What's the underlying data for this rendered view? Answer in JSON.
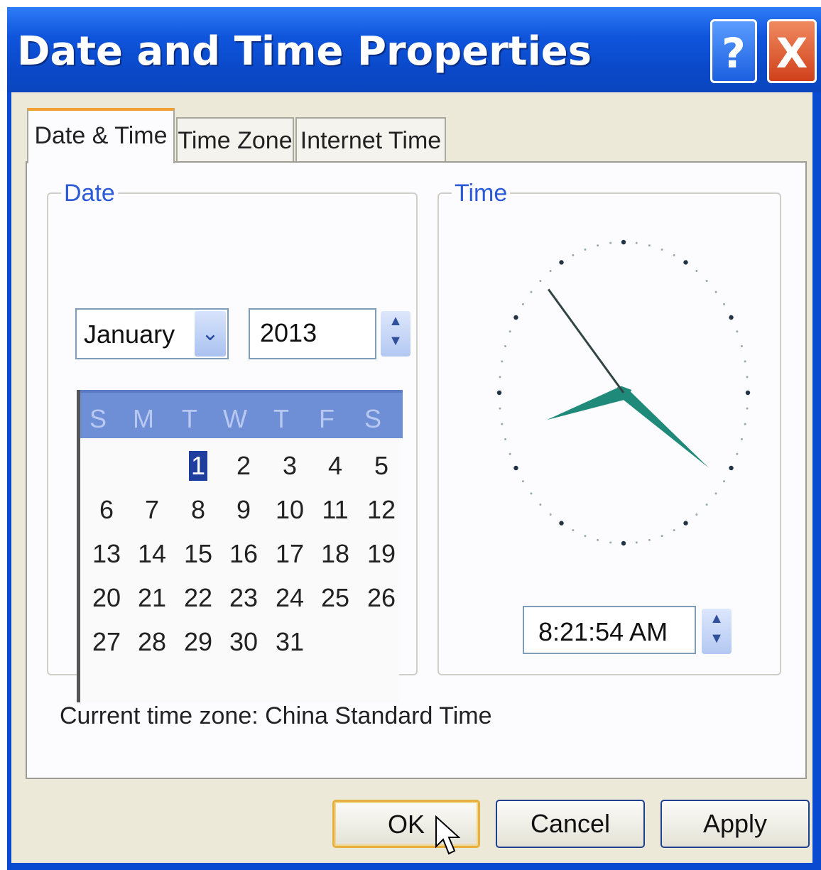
{
  "window": {
    "title": "Date and Time Properties",
    "help_glyph": "?",
    "close_glyph": "X"
  },
  "tabs": [
    {
      "label": "Date & Time",
      "active": true
    },
    {
      "label": "Time Zone",
      "active": false
    },
    {
      "label": "Internet Time",
      "active": false
    }
  ],
  "date_group": {
    "label": "Date",
    "month": "January",
    "year": "2013",
    "weekdays": [
      "S",
      "M",
      "T",
      "W",
      "T",
      "F",
      "S"
    ],
    "selected_day": "1",
    "days": [
      "1",
      "2",
      "3",
      "4",
      "5",
      "6",
      "7",
      "8",
      "9",
      "10",
      "11",
      "12",
      "13",
      "14",
      "15",
      "16",
      "17",
      "18",
      "19",
      "20",
      "21",
      "22",
      "23",
      "24",
      "25",
      "26",
      "27",
      "28",
      "29",
      "30",
      "31"
    ]
  },
  "time_group": {
    "label": "Time",
    "time": "8:21:54 AM",
    "clock": {
      "hour": 8,
      "minute": 21,
      "second": 54,
      "hand_color": "#1f8a7a"
    }
  },
  "timezone": {
    "label": "Current time zone:",
    "value": "China Standard Time"
  },
  "buttons": {
    "ok": "OK",
    "cancel": "Cancel",
    "apply": "Apply"
  },
  "colors": {
    "titlebar": "#0a48c8",
    "selection": "#1f3f9f",
    "calendar_header": "#6e8fd6"
  }
}
